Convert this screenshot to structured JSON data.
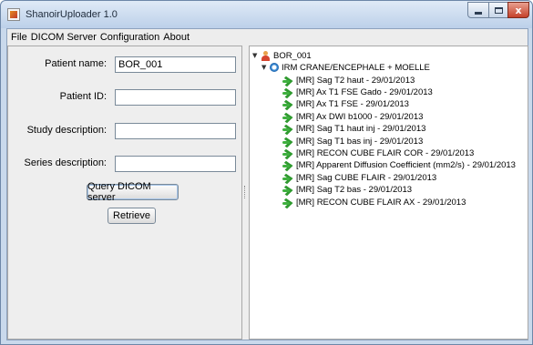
{
  "window": {
    "title": "ShanoirUploader 1.0",
    "icon": "java-app-icon",
    "controls": {
      "minimize_icon": "minimize-icon",
      "maximize_icon": "maximize-icon",
      "close_glyph": "x"
    }
  },
  "menu": {
    "items": [
      "File",
      "DICOM Server",
      "Configuration",
      "About"
    ]
  },
  "form": {
    "patient_name_label": "Patient name:",
    "patient_name_value": "BOR_001",
    "patient_id_label": "Patient ID:",
    "patient_id_value": "",
    "study_description_label": "Study description:",
    "study_description_value": "",
    "series_description_label": "Series description:",
    "series_description_value": "",
    "query_button": "Query DICOM server",
    "retrieve_button": "Retrieve"
  },
  "tree": {
    "patient": "BOR_001",
    "study": "IRM CRANE/ENCEPHALE + MOELLE",
    "series": [
      "[MR] Sag T2 haut - 29/01/2013",
      "[MR] Ax T1 FSE Gado - 29/01/2013",
      "[MR] Ax T1 FSE - 29/01/2013",
      "[MR] Ax DWI b1000 - 29/01/2013",
      "[MR] Sag T1 haut inj - 29/01/2013",
      "[MR] Sag T1 bas inj - 29/01/2013",
      "[MR] RECON CUBE FLAIR COR - 29/01/2013",
      "[MR] Apparent Diffusion Coefficient (mm2/s) - 29/01/2013",
      "[MR] Sag CUBE FLAIR - 29/01/2013",
      "[MR] Sag T2 bas - 29/01/2013",
      "[MR] RECON CUBE FLAIR AX - 29/01/2013"
    ]
  },
  "colors": {
    "title_bar": "#bcd0e9",
    "close_button": "#c5412a",
    "series_icon": "#2f9a2f"
  }
}
